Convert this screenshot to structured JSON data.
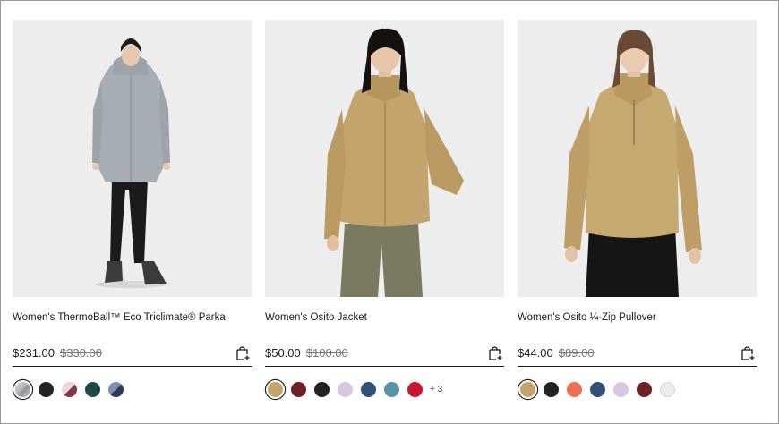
{
  "products": [
    {
      "name": "Women's ThermoBall™ Eco Triclimate® Parka",
      "price": "$231.00",
      "original_price": "$330.00",
      "image": "woman-in-grey-hooded-parka",
      "swatches": [
        {
          "color": "#b5b8bd",
          "selected": true
        },
        {
          "color": "#242424",
          "selected": false
        },
        {
          "color": "#8a4b55",
          "selected": false
        },
        {
          "color": "#1f4a44",
          "selected": false
        },
        {
          "color": "#3a4a6e",
          "selected": false
        }
      ],
      "more": ""
    },
    {
      "name": "Women's Osito Jacket",
      "price": "$50.00",
      "original_price": "$100.00",
      "image": "woman-in-tan-fleece-jacket",
      "swatches": [
        {
          "color": "#c1a36b",
          "selected": true
        },
        {
          "color": "#6e2126",
          "selected": false
        },
        {
          "color": "#232323",
          "selected": false
        },
        {
          "color": "#d8c8df",
          "selected": false
        },
        {
          "color": "#33507a",
          "selected": false
        },
        {
          "color": "#5a92a6",
          "selected": false
        },
        {
          "color": "#c8172e",
          "selected": false
        }
      ],
      "more": "+ 3"
    },
    {
      "name": "Women's Osito ¼-Zip Pullover",
      "price": "$44.00",
      "original_price": "$89.00",
      "image": "woman-in-tan-fleece-pullover",
      "swatches": [
        {
          "color": "#c1a36b",
          "selected": true
        },
        {
          "color": "#232323",
          "selected": false
        },
        {
          "color": "#ee6f55",
          "selected": false
        },
        {
          "color": "#33507a",
          "selected": false
        },
        {
          "color": "#d8c8df",
          "selected": false
        },
        {
          "color": "#6e2126",
          "selected": false
        },
        {
          "color": "#ececec",
          "selected": false
        }
      ],
      "more": ""
    }
  ]
}
